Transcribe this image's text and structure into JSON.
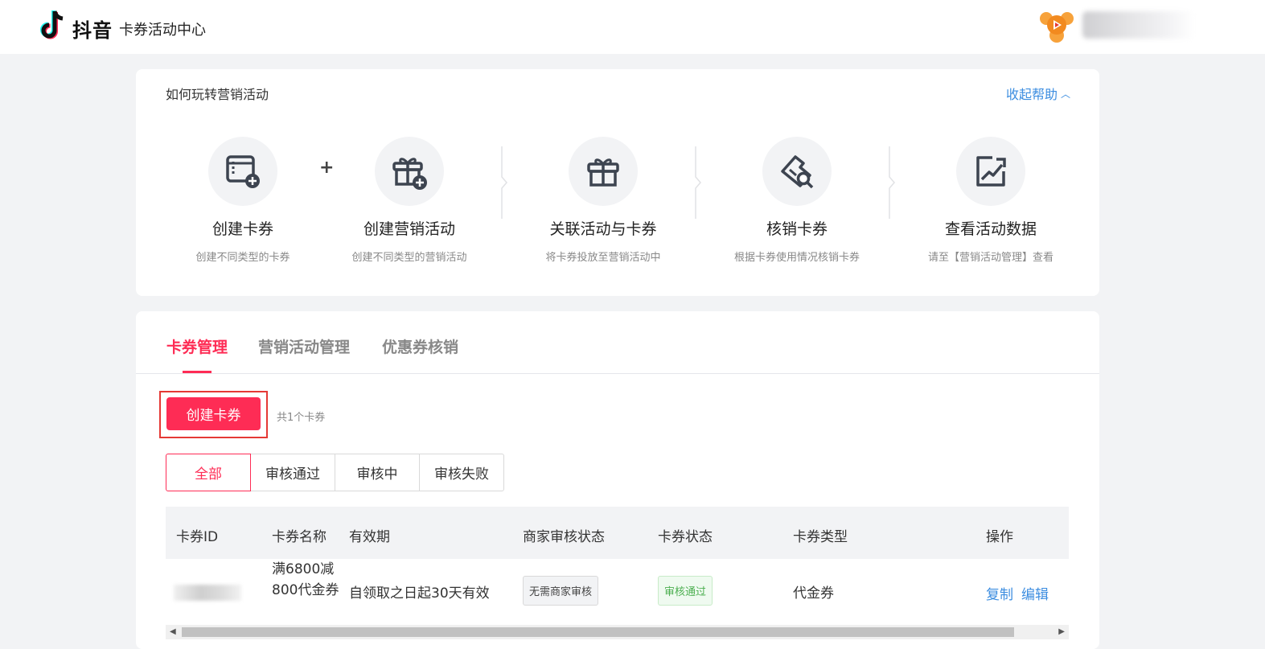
{
  "header": {
    "brand": "抖音",
    "subtitle": "卡券活动中心"
  },
  "help": {
    "title": "如何玩转营销活动",
    "toggle": "收起帮助",
    "plus": "+",
    "steps": [
      {
        "label": "创建卡券",
        "desc": "创建不同类型的卡券",
        "icon": "coupon-add-icon"
      },
      {
        "label": "创建营销活动",
        "desc": "创建不同类型的营销活动",
        "icon": "gift-add-icon"
      },
      {
        "label": "关联活动与卡券",
        "desc": "将卡券投放至营销活动中",
        "icon": "gift-icon"
      },
      {
        "label": "核销卡券",
        "desc": "根据卡券使用情况核销卡券",
        "icon": "ticket-search-icon"
      },
      {
        "label": "查看活动数据",
        "desc": "请至【营销活动管理】查看",
        "icon": "chart-trend-icon"
      }
    ]
  },
  "tabs": [
    "卡券管理",
    "营销活动管理",
    "优惠券核销"
  ],
  "active_tab": "卡券管理",
  "toolbar": {
    "create_label": "创建卡券",
    "count_text": "共1个卡券"
  },
  "filters": [
    "全部",
    "审核通过",
    "审核中",
    "审核失败"
  ],
  "active_filter": "全部",
  "table": {
    "columns": [
      "卡券ID",
      "卡券名称",
      "有效期",
      "商家审核状态",
      "卡券状态",
      "卡券类型",
      "操作"
    ],
    "rows": [
      {
        "name": "满6800减800代金券",
        "validity": "自领取之日起30天有效",
        "merchant_status": "无需商家审核",
        "status": "审核通过",
        "type": "代金券",
        "actions": [
          "复制",
          "编辑"
        ]
      }
    ]
  },
  "colors": {
    "accent": "#fe2c55",
    "link": "#3c8de0",
    "success": "#4caf50"
  }
}
